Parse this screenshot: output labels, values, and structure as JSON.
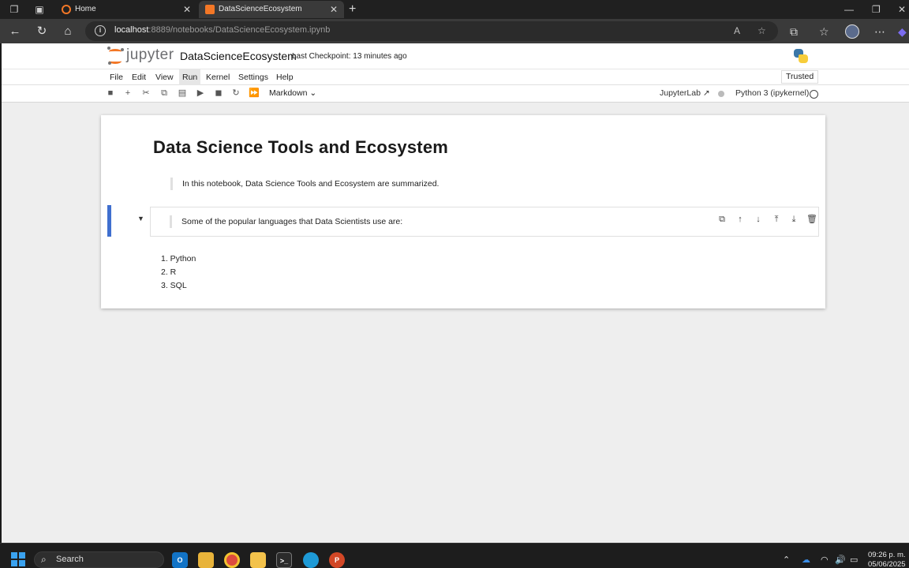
{
  "browser": {
    "tabs": [
      {
        "label": "Home",
        "active": false
      },
      {
        "label": "DataScienceEcosystem",
        "active": true
      }
    ],
    "url_host": "localhost",
    "url_rest": ":8889/notebooks/DataScienceEcosystem.ipynb"
  },
  "jupyter": {
    "logo_text": "jupyter",
    "notebook_name": "DataScienceEcosystem",
    "checkpoint": "Last Checkpoint: 13 minutes ago",
    "menu": [
      "File",
      "Edit",
      "View",
      "Run",
      "Kernel",
      "Settings",
      "Help"
    ],
    "highlighted_menu": "Run",
    "trusted": "Trusted",
    "cell_type": "Markdown",
    "jupyterlab_link": "JupyterLab",
    "kernel_name": "Python 3 (ipykernel)"
  },
  "notebook": {
    "title": "Data Science Tools and Ecosystem",
    "intro": "In this notebook, Data Science Tools and Ecosystem are summarized.",
    "languages_intro": "Some of the popular languages that Data Scientists use are:",
    "languages": [
      "1. Python",
      "2. R",
      "3. SQL"
    ]
  },
  "taskbar": {
    "search_placeholder": "Search",
    "time": "09:26 p. m.",
    "date": "05/06/2025"
  },
  "colors": {
    "jupyter_orange": "#f37726",
    "active_cell_bar": "#3f6fcf",
    "page_bg": "#eeeeee"
  }
}
